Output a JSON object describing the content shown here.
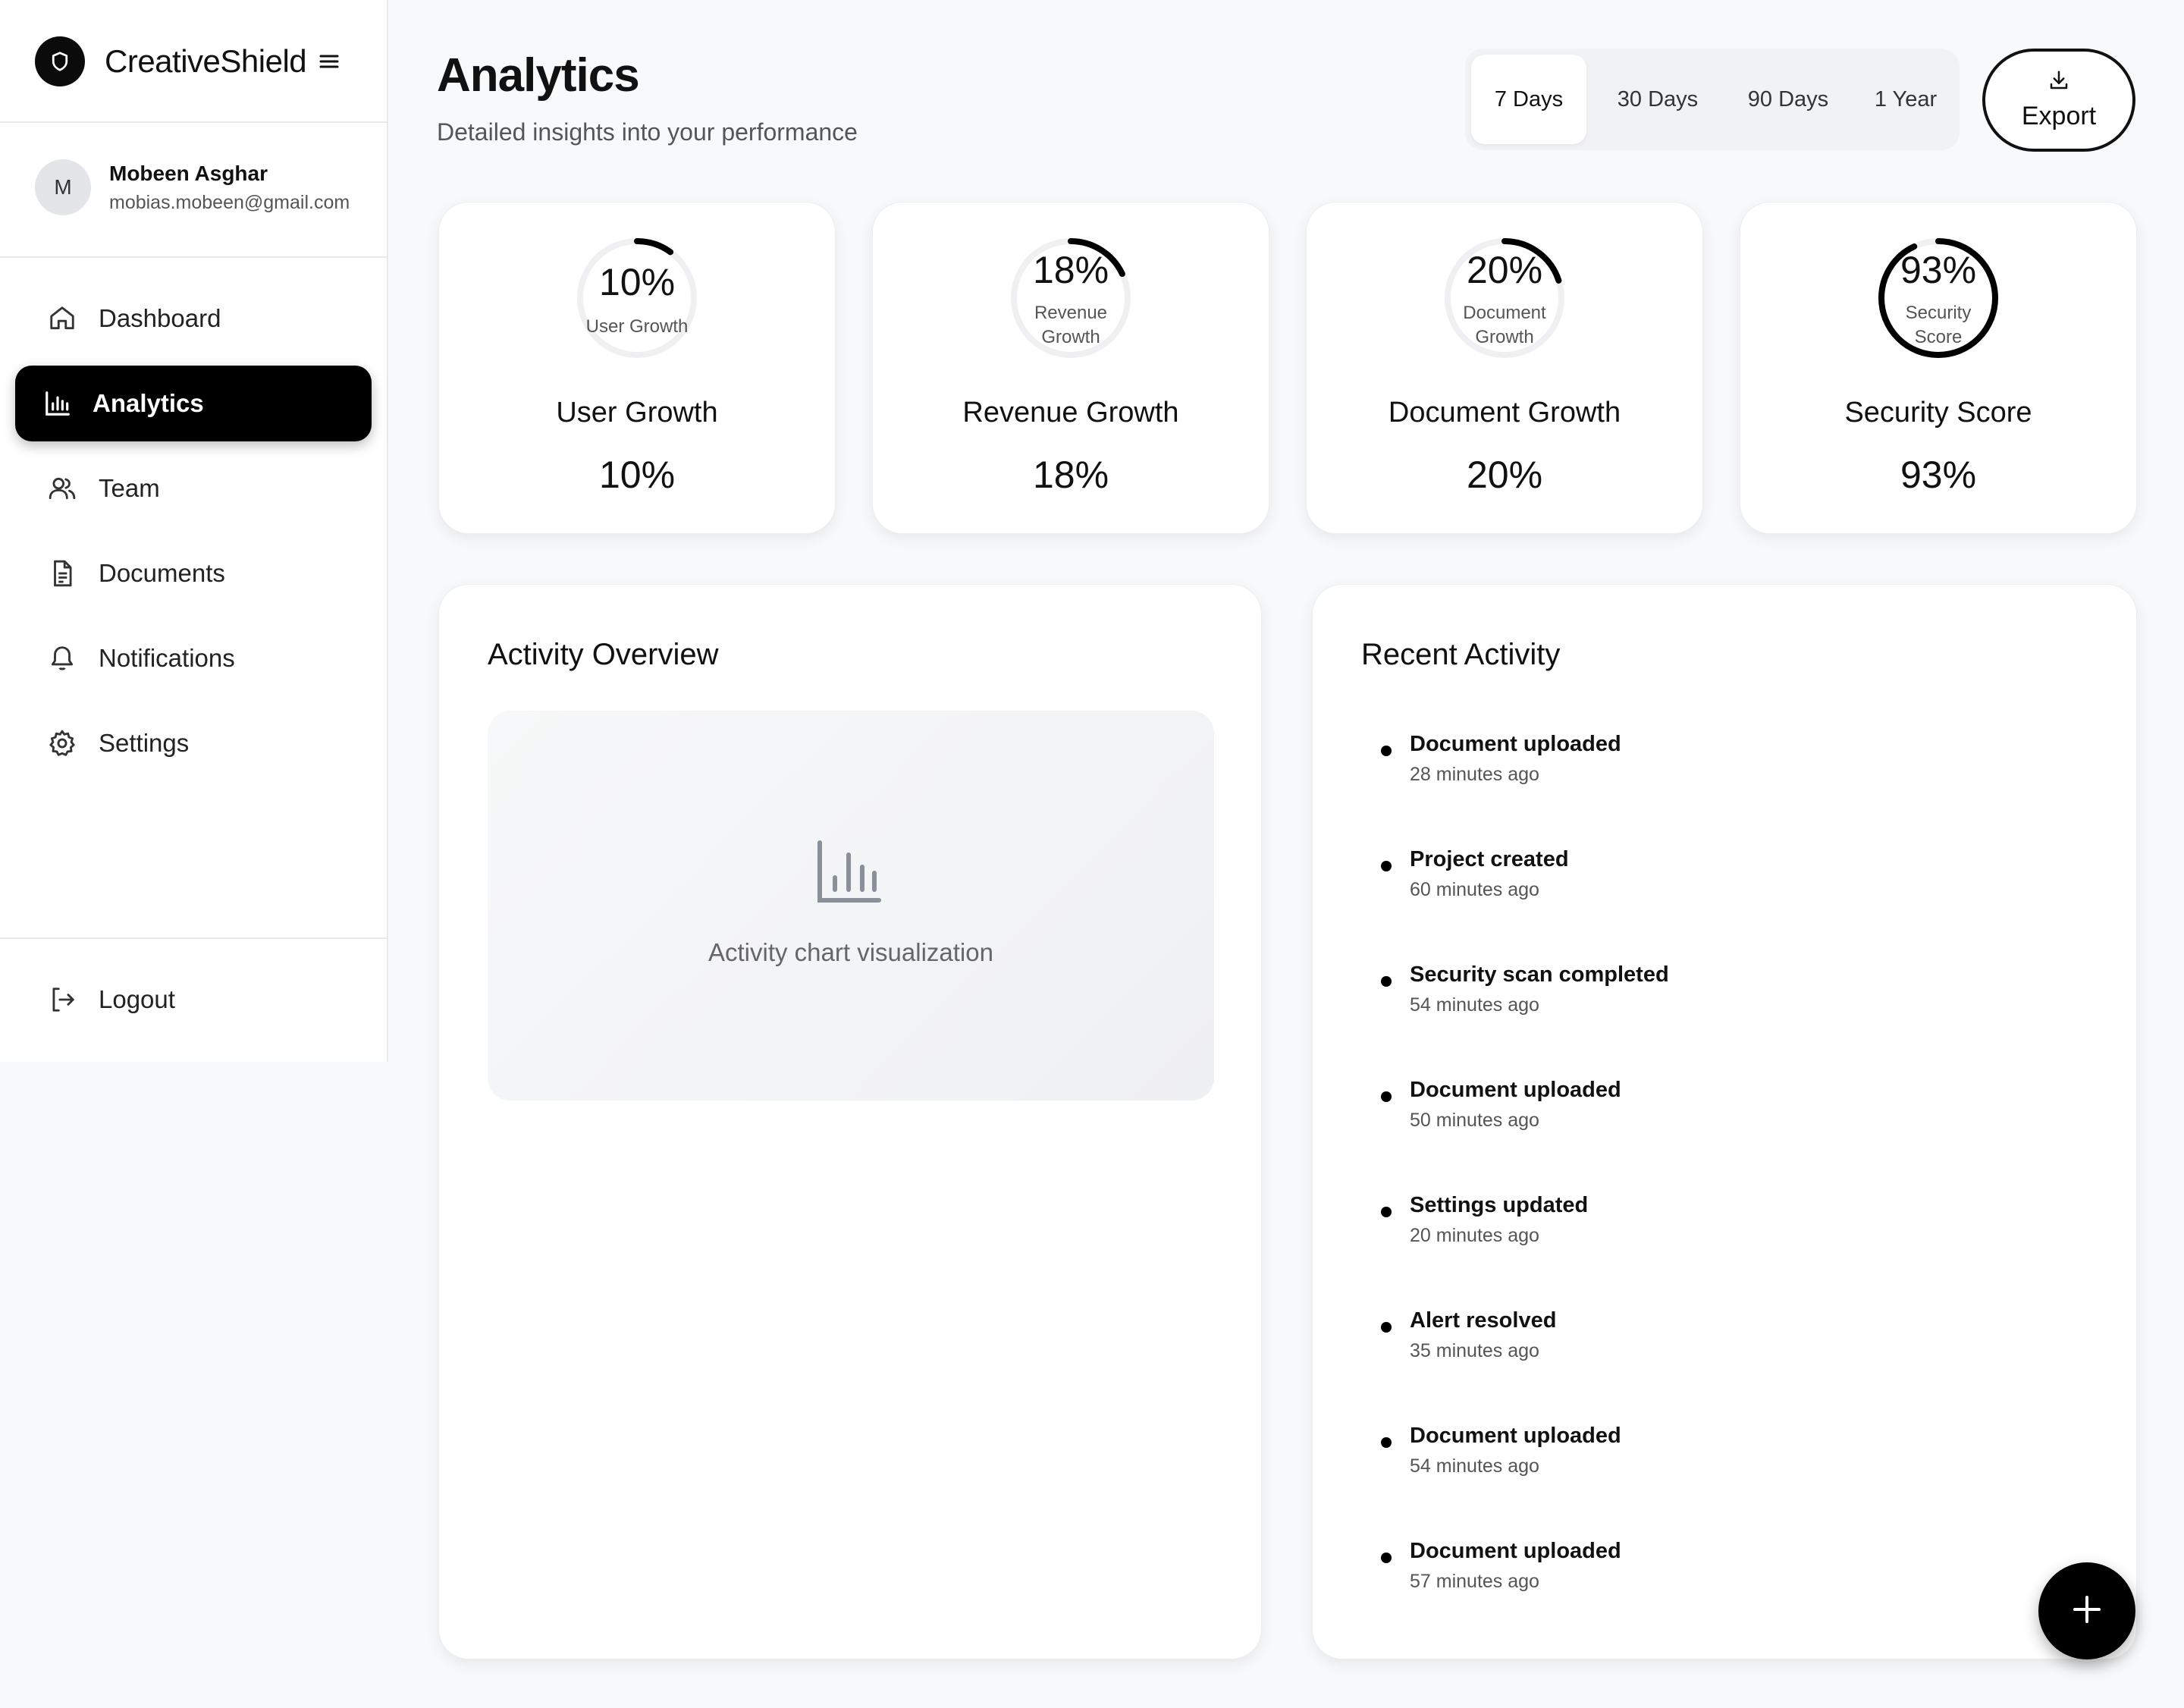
{
  "brand": {
    "name": "CreativeShield",
    "logo_icon": "shield-icon",
    "menu_icon": "hamburger-icon"
  },
  "user": {
    "initial": "M",
    "name": "Mobeen Asghar",
    "email": "mobias.mobeen@gmail.com"
  },
  "nav": {
    "items": [
      {
        "label": "Dashboard",
        "icon": "home-icon",
        "active": false
      },
      {
        "label": "Analytics",
        "icon": "bar-chart-icon",
        "active": true
      },
      {
        "label": "Team",
        "icon": "users-icon",
        "active": false
      },
      {
        "label": "Documents",
        "icon": "document-icon",
        "active": false
      },
      {
        "label": "Notifications",
        "icon": "bell-icon",
        "active": false
      },
      {
        "label": "Settings",
        "icon": "gear-icon",
        "active": false
      }
    ],
    "logout": {
      "label": "Logout",
      "icon": "logout-icon"
    }
  },
  "header": {
    "title": "Analytics",
    "subtitle": "Detailed insights into your performance",
    "ranges": [
      "7 Days",
      "30 Days",
      "90 Days",
      "1 Year"
    ],
    "selected_range": "7 Days",
    "export_label": "Export",
    "export_icon": "download-icon"
  },
  "stats": [
    {
      "ring_value": "10%",
      "ring_label": "User Growth",
      "title": "User Growth",
      "value": "10%",
      "percent": 10
    },
    {
      "ring_value": "18%",
      "ring_label": "Revenue Growth",
      "title": "Revenue Growth",
      "value": "18%",
      "percent": 18
    },
    {
      "ring_value": "20%",
      "ring_label": "Document Growth",
      "title": "Document Growth",
      "value": "20%",
      "percent": 20
    },
    {
      "ring_value": "93%",
      "ring_label": "Security Score",
      "title": "Security Score",
      "value": "93%",
      "percent": 93
    }
  ],
  "activity_overview": {
    "title": "Activity Overview",
    "placeholder_icon": "bar-chart-icon",
    "placeholder_text": "Activity chart visualization"
  },
  "recent_activity": {
    "title": "Recent Activity",
    "items": [
      {
        "title": "Document uploaded",
        "time": "28 minutes ago"
      },
      {
        "title": "Project created",
        "time": "60 minutes ago"
      },
      {
        "title": "Security scan completed",
        "time": "54 minutes ago"
      },
      {
        "title": "Document uploaded",
        "time": "50 minutes ago"
      },
      {
        "title": "Settings updated",
        "time": "20 minutes ago"
      },
      {
        "title": "Alert resolved",
        "time": "35 minutes ago"
      },
      {
        "title": "Document uploaded",
        "time": "54 minutes ago"
      },
      {
        "title": "Document uploaded",
        "time": "57 minutes ago"
      }
    ]
  },
  "fab": {
    "icon": "plus-icon"
  },
  "colors": {
    "accent": "#000000",
    "background": "#f8f9fb",
    "card": "#ffffff",
    "ring_track": "#f0f0f2"
  }
}
